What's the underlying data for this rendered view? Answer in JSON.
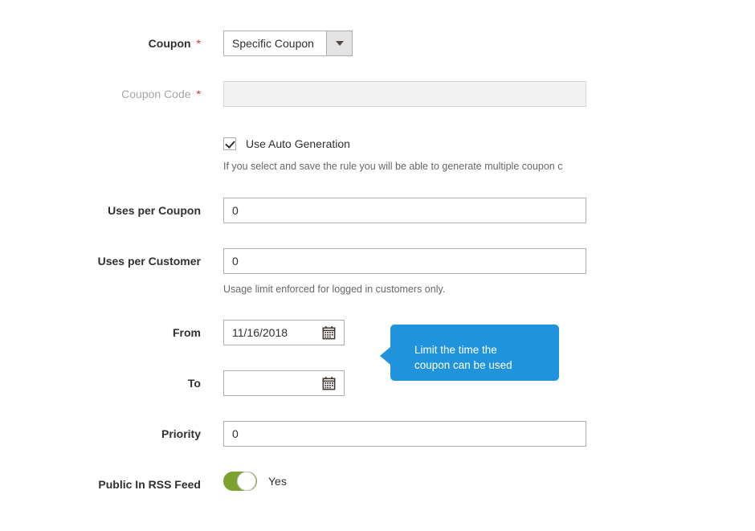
{
  "form": {
    "rows": {
      "coupon": {
        "label": "Coupon",
        "required_marker": "*",
        "selected_option": "Specific Coupon"
      },
      "coupon_code": {
        "label": "Coupon Code",
        "required_marker": "*",
        "value": "",
        "state": "disabled"
      },
      "auto_generation": {
        "checkbox_label": "Use Auto Generation",
        "checked": true,
        "note": "If you select and save the rule you will be able to generate multiple coupon c"
      },
      "uses_per_coupon": {
        "label": "Uses per Coupon",
        "value": "0"
      },
      "uses_per_customer": {
        "label": "Uses per Customer",
        "value": "0",
        "note": "Usage limit enforced for logged in customers only."
      },
      "from": {
        "label": "From",
        "value": "11/16/2018",
        "calendar_icon": "calendar-icon"
      },
      "to": {
        "label": "To",
        "value": "",
        "calendar_icon": "calendar-icon"
      },
      "priority": {
        "label": "Priority",
        "value": "0"
      },
      "public_in_rss_feed": {
        "label": "Public In RSS Feed",
        "toggle_state": "Yes",
        "toggle_on": true
      }
    }
  },
  "callout": {
    "line1": "Limit the time the",
    "line2": "coupon can be used",
    "color": "#1f93db",
    "text_color": "#ffffff"
  },
  "colors": {
    "required_star": "#e02b27",
    "label_text": "#303030",
    "muted_label": "#a6a6a6",
    "input_border": "#adadad",
    "disabled_fill": "#f2f2f2",
    "note_text": "#666666",
    "toggle_on": "#79a22e",
    "select_button_fill": "#e3e3e3"
  }
}
